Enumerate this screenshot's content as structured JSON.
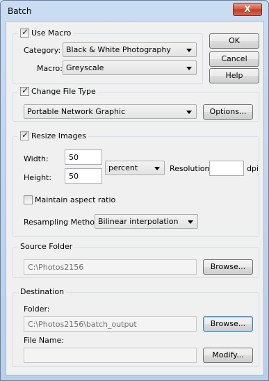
{
  "window": {
    "title": "Batch",
    "close_glyph": "X"
  },
  "macro": {
    "checkbox_label": "Use Macro",
    "checked": true,
    "category_label": "Category:",
    "category_value": "Black & White Photography",
    "macro_label": "Macro:",
    "macro_value": "Greyscale"
  },
  "buttons": {
    "ok": "OK",
    "cancel": "Cancel",
    "help": "Help"
  },
  "file_type": {
    "checkbox_label": "Change File Type",
    "checked": true,
    "format_value": "Portable Network Graphic",
    "options_label": "Options..."
  },
  "resize": {
    "checkbox_label": "Resize Images",
    "checked": true,
    "width_label": "Width:",
    "width_value": "50",
    "height_label": "Height:",
    "height_value": "50",
    "unit_value": "percent",
    "resolution_label": "Resolution:",
    "resolution_value": "",
    "resolution_unit": "dpi",
    "aspect_label": "Maintain aspect ratio",
    "aspect_checked": false,
    "resampling_label": "Resampling Method:",
    "resampling_value": "Bilinear interpolation"
  },
  "source": {
    "group_label": "Source Folder",
    "path": "C:\\Photos2156",
    "browse_label": "Browse..."
  },
  "destination": {
    "group_label": "Destination",
    "folder_label": "Folder:",
    "folder_path": "C:\\Photos2156\\batch_output",
    "browse_label": "Browse...",
    "filename_label": "File Name:",
    "filename_value": "",
    "modify_label": "Modify..."
  }
}
